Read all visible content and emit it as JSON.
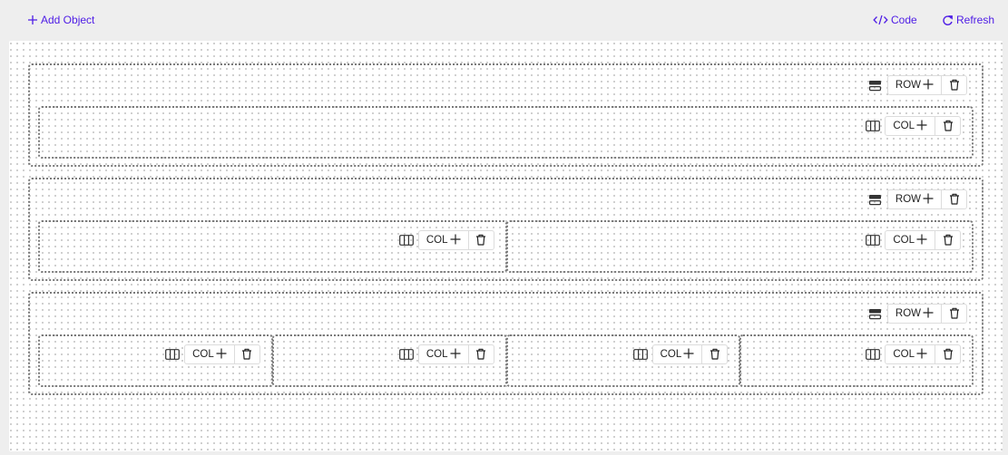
{
  "topbar": {
    "add_object_label": "Add Object",
    "code_label": "Code",
    "refresh_label": "Refresh",
    "accent_color": "#4f1ee6"
  },
  "icons": {
    "plus": "plus-icon",
    "code": "code-icon",
    "refresh": "refresh-icon",
    "row_handle": "row-layout-icon",
    "col_handle": "column-layout-icon",
    "trash": "trash-icon"
  },
  "rows": [
    {
      "add_label": "ROW",
      "columns": [
        {
          "add_label": "COL"
        }
      ]
    },
    {
      "add_label": "ROW",
      "columns": [
        {
          "add_label": "COL"
        },
        {
          "add_label": "COL"
        }
      ]
    },
    {
      "add_label": "ROW",
      "columns": [
        {
          "add_label": "COL"
        },
        {
          "add_label": "COL"
        },
        {
          "add_label": "COL"
        },
        {
          "add_label": "COL"
        }
      ]
    }
  ]
}
